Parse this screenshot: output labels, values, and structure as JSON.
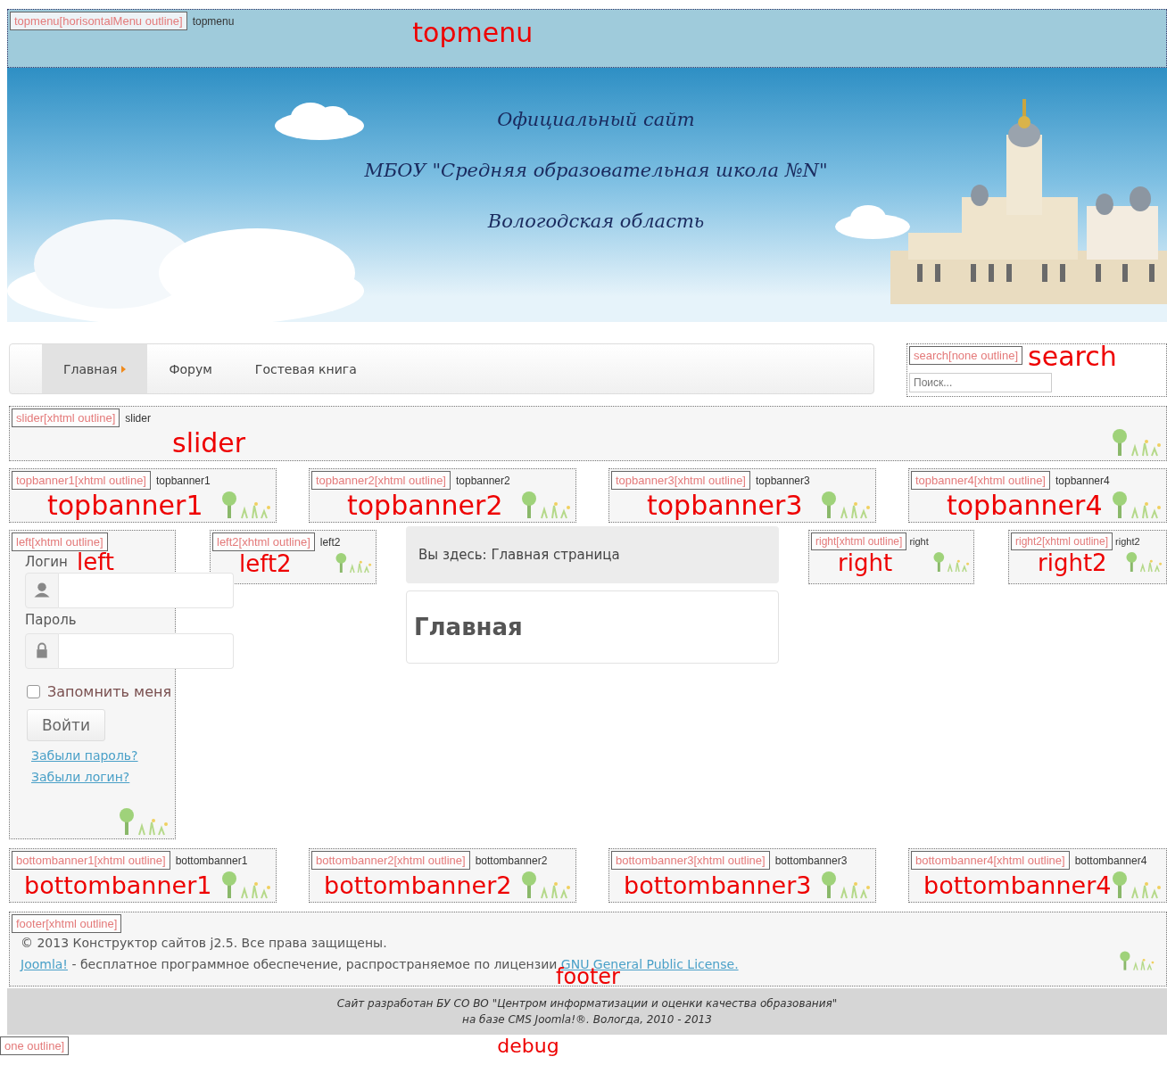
{
  "topmenu": {
    "tag": "topmenu[horisontalMenu outline]",
    "title": "topmenu",
    "label": "topmenu"
  },
  "header": {
    "lines": [
      "Официальный сайт",
      "МБОУ \"Средняя образовательная школа №N\"",
      "Вологодская область"
    ]
  },
  "nav": {
    "items": [
      {
        "label": "Главная",
        "selected": true
      },
      {
        "label": "Форум",
        "selected": false
      },
      {
        "label": "Гостевая книга",
        "selected": false
      }
    ]
  },
  "search": {
    "tag": "search[none outline]",
    "placeholder": "Поиск...",
    "label": "search"
  },
  "slider": {
    "tag": "slider[xhtml outline]",
    "title": "slider",
    "label": "slider"
  },
  "topbanners": [
    {
      "tag": "topbanner1[xhtml outline]",
      "title": "topbanner1",
      "label": "topbanner1"
    },
    {
      "tag": "topbanner2[xhtml outline]",
      "title": "topbanner2",
      "label": "topbanner2"
    },
    {
      "tag": "topbanner3[xhtml outline]",
      "title": "topbanner3",
      "label": "topbanner3"
    },
    {
      "tag": "topbanner4[xhtml outline]",
      "title": "topbanner4",
      "label": "topbanner4"
    }
  ],
  "left": {
    "tag": "left[xhtml outline]",
    "label": "left",
    "login_label": "Логин",
    "password_label": "Пароль",
    "remember": {
      "label": "Запомнить меня",
      "checked": false
    },
    "button": "Войти",
    "links": [
      "Забыли пароль?",
      "Забыли логин?"
    ]
  },
  "left2": {
    "tag": "left2[xhtml outline]",
    "title": "left2",
    "label": "left2"
  },
  "breadcrumb": "Вы здесь: Главная страница",
  "article_title": "Главная",
  "right": {
    "tag": "right[xhtml outline]",
    "title": "right",
    "label": "right"
  },
  "right2": {
    "tag": "right2[xhtml outline]",
    "title": "right2",
    "label": "right2"
  },
  "bottombanners": [
    {
      "tag": "bottombanner1[xhtml outline]",
      "title": "bottombanner1",
      "label": "bottombanner1"
    },
    {
      "tag": "bottombanner2[xhtml outline]",
      "title": "bottombanner2",
      "label": "bottombanner2"
    },
    {
      "tag": "bottombanner3[xhtml outline]",
      "title": "bottombanner3",
      "label": "bottombanner3"
    },
    {
      "tag": "bottombanner4[xhtml outline]",
      "title": "bottombanner4",
      "label": "bottombanner4"
    }
  ],
  "footer": {
    "tag": "footer[xhtml outline]",
    "copyright": "© 2013 Конструктор сайтов j2.5. Все права защищены.",
    "license": [
      {
        "kind": "link",
        "text": "Joomla!"
      },
      {
        "kind": "text",
        "text": " - бесплатное программное обеспечение, распространяемое по лицензии "
      },
      {
        "kind": "link",
        "text": "GNU General Public License."
      }
    ],
    "label": "footer"
  },
  "credits": [
    "Сайт разработан БУ СО ВО \"Центром информатизации и оценки качества образования\"",
    "на базе CMS Joomla!®. Вологда, 2010 - 2013"
  ],
  "debug": {
    "tag": "one outline]",
    "label": "debug"
  }
}
